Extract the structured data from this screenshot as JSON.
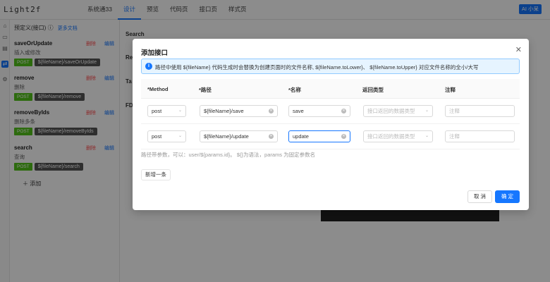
{
  "app": {
    "title": "Light2f"
  },
  "nav": {
    "items": [
      "系统通33",
      "设计",
      "预览",
      "代码页",
      "接口页",
      "样式页"
    ]
  },
  "ai_button": "AI 小呆",
  "sidebar": {
    "header": "预定义(接口)",
    "doc_link": "更多文档",
    "delete_label": "删除",
    "edit_label": "编辑",
    "add_label": "添加",
    "items": [
      {
        "name": "saveOrUpdate",
        "desc": "插入或修改",
        "method": "POST",
        "path": "${fileName}/saveOrUpdate"
      },
      {
        "name": "remove",
        "desc": "删除",
        "method": "POST",
        "path": "${fileName}/remove"
      },
      {
        "name": "removeByIds",
        "desc": "删除多条",
        "method": "POST",
        "path": "${fileName}/removeByIds"
      },
      {
        "name": "search",
        "desc": "查询",
        "method": "POST",
        "path": "${fileName}/search"
      }
    ]
  },
  "background": {
    "rows": [
      "Search",
      "Re",
      "Ta",
      "FD"
    ]
  },
  "modal": {
    "title": "添加接口",
    "info": "路径中使用 ${fileName} 代码生成时会替换为创建页面时的文件名称, ${fileName.toLower}、 ${fileName.toUpper} 对应文件名称的全小/大写",
    "columns": [
      "*Method",
      "*路径",
      "*名称",
      "返回类型",
      "注释"
    ],
    "rows": [
      {
        "method": "post",
        "path": "${fileName}/save",
        "name": "save",
        "return_placeholder": "接口返回的数据类型",
        "comment_placeholder": "注释"
      },
      {
        "method": "post",
        "path": "${fileName}/update",
        "name": "update",
        "return_placeholder": "接口返回的数据类型",
        "comment_placeholder": "注释"
      }
    ],
    "hint": "路径带参数，可以：user/${params.id}。 ${}为语法，params 为固定参数名",
    "add_row": "新增一条",
    "cancel": "取 消",
    "ok": "确 定"
  }
}
